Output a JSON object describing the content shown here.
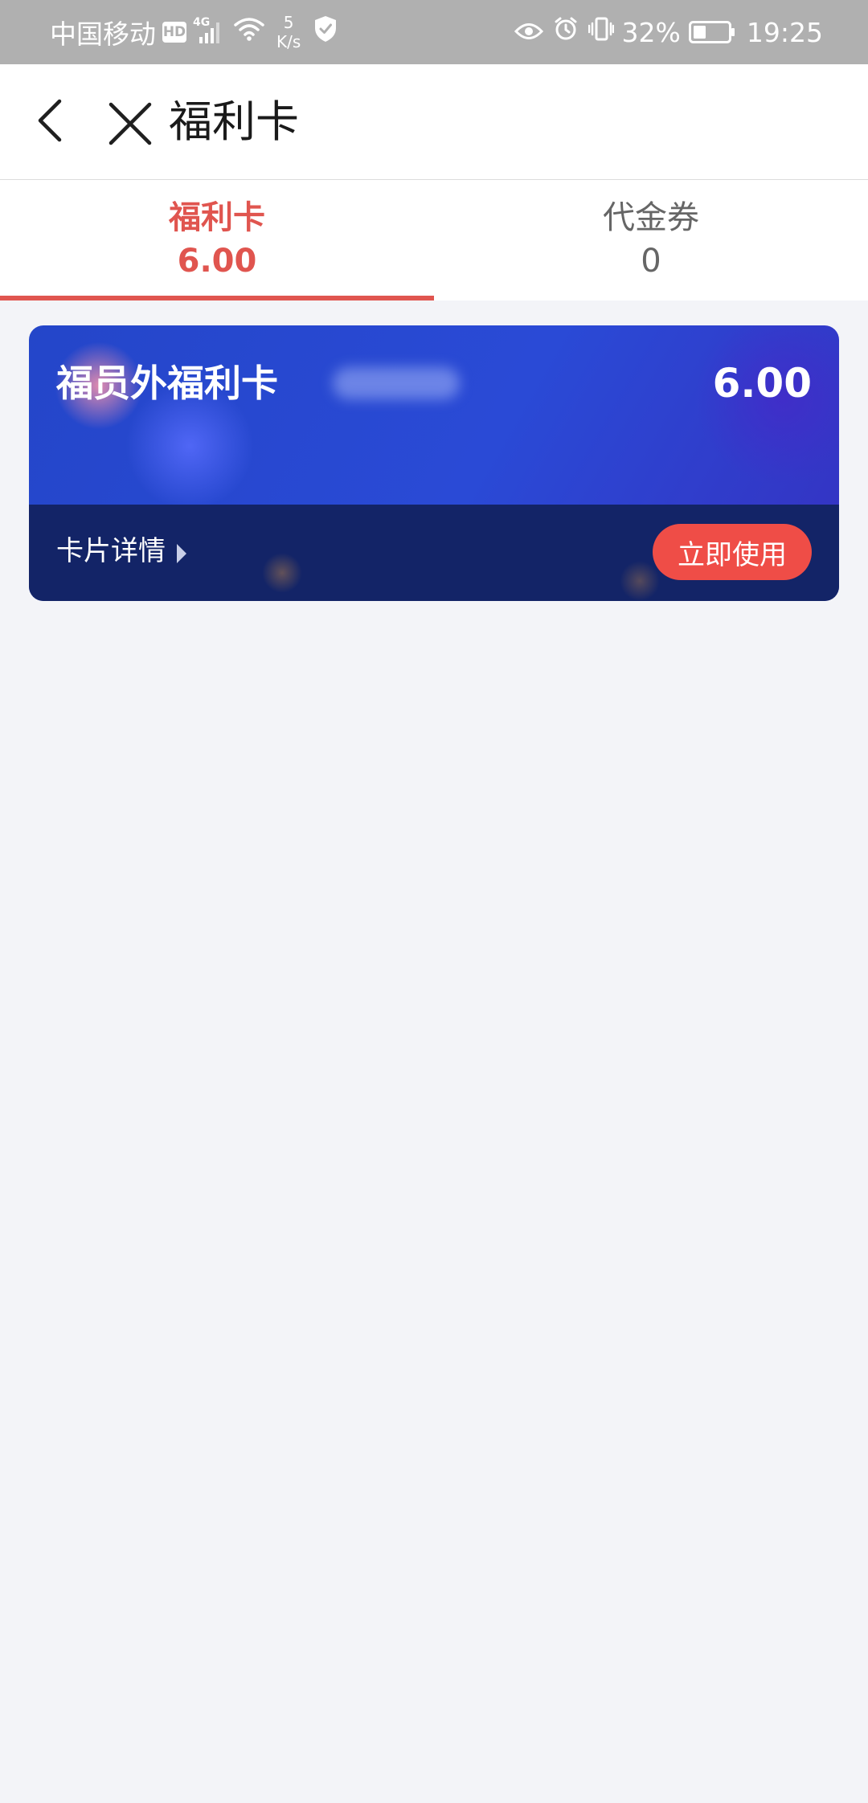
{
  "status_bar": {
    "carrier": "中国移动",
    "hd": "HD",
    "network": "4G",
    "speed_value": "5",
    "speed_unit": "K/s",
    "battery": "32%",
    "time": "19:25",
    "icons": [
      "hd-icon",
      "signal-icon",
      "wifi-icon",
      "shield-icon",
      "eye-icon",
      "alarm-icon",
      "vibrate-icon",
      "battery-icon"
    ]
  },
  "header": {
    "title": "福利卡",
    "back_icon": "chevron-left-icon",
    "close_icon": "close-icon"
  },
  "tabs": [
    {
      "label": "福利卡",
      "count": "6.00",
      "active": true
    },
    {
      "label": "代金券",
      "count": "0",
      "active": false
    }
  ],
  "card": {
    "name": "福员外福利卡",
    "balance": "6.00",
    "detail_label": "卡片详情",
    "use_label": "立即使用"
  },
  "colors": {
    "accent": "#e0554f",
    "card_blue": "#2a4ad6",
    "card_footer": "#132467",
    "button_red": "#ef4d47",
    "background": "#f3f4f8"
  }
}
